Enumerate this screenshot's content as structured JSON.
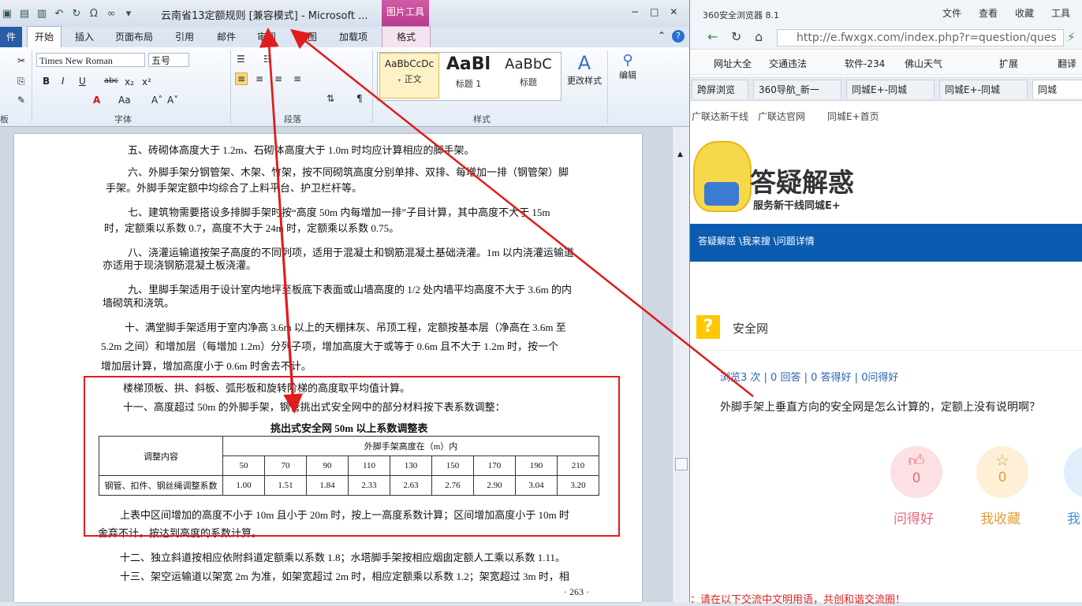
{
  "word": {
    "window_title": "云南省13定额规则 [兼容模式] - Microsoft ...",
    "picture_tools": "图片工具",
    "window_controls": [
      "−",
      "□",
      "✕"
    ],
    "tabs": {
      "file": "件",
      "home": "开始",
      "insert": "插入",
      "layout": "页面布局",
      "references": "引用",
      "mailings": "邮件",
      "review": "审阅",
      "view": "视图",
      "addins": "加载项",
      "format": "格式"
    },
    "font_name": "Times New Roman",
    "font_size": "五号",
    "group_labels": {
      "clipboard": "板",
      "font": "字体",
      "paragraph": "段落",
      "styles": "样式"
    },
    "styles": [
      {
        "preview": "AaBbCcDc",
        "name": "₊ 正文"
      },
      {
        "preview": "AaBl",
        "name": "标题 1"
      },
      {
        "preview": "AaBbC",
        "name": "标题"
      }
    ],
    "change_styles": "更改样式",
    "editing": "编辑",
    "doc_lines": [
      "五、砖砌体高度大于 1.2m、石砌体高度大于 1.0m 时均应计算相应的脚手架。",
      "六、外脚手架分钢管架、木架、竹架，按不同砌筑高度分别单排、双排、每增加一排（钢管架）脚",
      "手架。外脚手架定额中均综合了上料平台、护卫栏杆等。",
      "七、建筑物需要搭设多排脚手架时按“高度 50m 内每增加一排”子目计算，其中高度不大于 15m",
      "时，定额乘以系数 0.7，高度不大于 24m 时，定额乘以系数 0.75。",
      "八、浇灌运输道按架子高度的不同列项，适用于混凝土和钢筋混凝土基础浇灌。1m 以内浇灌运输道",
      "亦适用于现浇钢筋混凝土板浇灌。",
      "九、里脚手架适用于设计室内地坪至板底下表面或山墙高度的 1/2 处内墙平均高度不大于 3.6m 的内",
      "墙砌筑和浇筑。",
      "十、满堂脚手架适用于室内净高 3.6m 以上的天棚抹灰、吊顶工程，定额按基本层（净高在 3.6m 至",
      "5.2m 之间）和增加层（每增加 1.2m）分列子项，增加高度大于或等于 0.6m 且不大于 1.2m 时，按一个",
      "增加层计算，增加高度小于 0.6m 时舍去不计。",
      "楼梯顶板、拱、斜板、弧形板和旋转阶梯的高度取平均值计算。",
      "十一、高度超过 50m 的外脚手架，钢管挑出式安全网中的部分材料按下表系数调整：",
      "上表中区间增加的高度不小于 10m 且小于 20m 时，按上一高度系数计算；区间增加高度小于 10m 时",
      "舍弃不计，按达到高度的系数计算。",
      "十二、独立斜道按相应依附斜道定额乘以系数 1.8；水塔脚手架按相应烟囱定额人工乘以系数 1.11。",
      "十三、架空运输道以架宽 2m 为准，如架宽超过 2m 时，相应定额乘以系数 1.2；架宽超过 3m 时，相"
    ],
    "table": {
      "title": "挑出式安全网 50m 以上系数调整表",
      "row_header": "调整内容",
      "col_header": "外脚手架高度在（m）内",
      "heights": [
        "50",
        "70",
        "90",
        "110",
        "130",
        "150",
        "170",
        "190",
        "210"
      ],
      "row_label": "钢管、扣件、钢丝绳调整系数",
      "coefficients": [
        "1.00",
        "1.51",
        "1.84",
        "2.33",
        "2.63",
        "2.76",
        "2.90",
        "3.04",
        "3.20"
      ]
    },
    "page_number": "· 263 ·"
  },
  "browser": {
    "title": "360安全浏览器 8.1",
    "menu": [
      "文件",
      "查看",
      "收藏",
      "工具"
    ],
    "url": "http://e.fwxgx.com/index.php?r=question/ques",
    "bookmarks": [
      "网址大全",
      "交通违法",
      "软件-234",
      "佛山天气",
      "扩展",
      "翻译"
    ],
    "tabs": [
      "跨屏浏览",
      "360导航_新一",
      "同城E+-同城",
      "同城E+-同城",
      "同城"
    ],
    "site_nav": [
      "广联达新干线",
      "广联达官网",
      "同城E+首页"
    ],
    "banner_title": "答疑解惑",
    "banner_sub": "服务新干线同城E+",
    "breadcrumb": "答疑解惑 \\我来搜 \\问题详情",
    "question_title": "安全网",
    "question_stats": "浏览3 次 | 0 回答 | 0 答得好 | 0问得好",
    "question_body": "外脚手架上垂直方向的安全网是怎么计算的，定额上没有说明啊？",
    "actions": [
      {
        "label": "问得好",
        "count": "0",
        "icon": "thumbs-up-icon",
        "color": "#e86a7a",
        "bg": "#fde0e4"
      },
      {
        "label": "我收藏",
        "count": "0",
        "icon": "star-icon",
        "color": "#e0a13a",
        "bg": "#fdf0d6"
      },
      {
        "label": "我",
        "count": "",
        "icon": "share-icon",
        "color": "#4a90d9",
        "bg": "#e0eefb"
      }
    ],
    "bottom_note": "：请在以下交流中文明用语，共创和谐交流圈！"
  },
  "colors": {
    "annotation_red": "#e01c1c",
    "word_blue": "#2a5ca8",
    "site_blue": "#0b5cb0"
  }
}
